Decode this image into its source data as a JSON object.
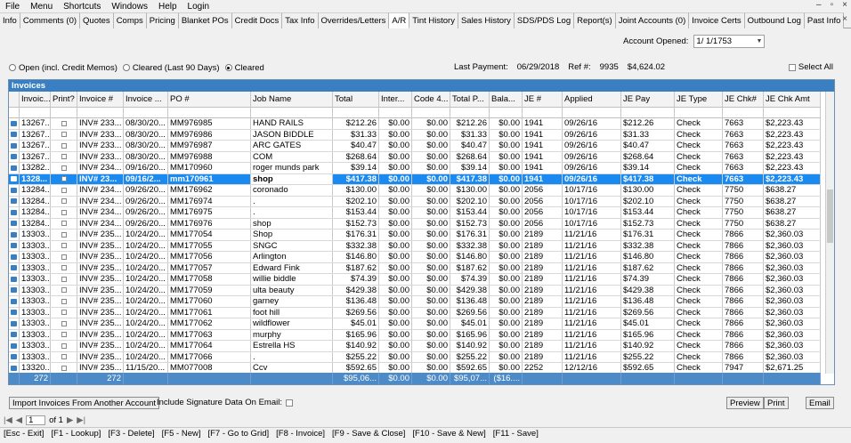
{
  "menu": [
    "File",
    "Menu",
    "Shortcuts",
    "Windows",
    "Help",
    "Login"
  ],
  "window_controls": {
    "min": "–",
    "restore": "▫",
    "close": "×"
  },
  "tabs": [
    "Info",
    "Comments (0)",
    "Quotes",
    "Comps",
    "Pricing",
    "Blanket POs",
    "Credit Docs",
    "Tax Info",
    "Overrides/Letters",
    "A/R",
    "Tint History",
    "Sales History",
    "SDS/PDS Log",
    "Report(s)",
    "Joint Accounts (0)",
    "Invoice Certs",
    "Outbound Log",
    "Past Info"
  ],
  "active_tab": "A/R",
  "account_opened": {
    "label": "Account Opened:",
    "value": "1/  1/1753"
  },
  "filters": {
    "open": "Open (incl. Credit Memos)",
    "cleared90": "Cleared (Last 90 Days)",
    "cleared": "Cleared",
    "selected": "cleared"
  },
  "payment": {
    "last_payment_label": "Last Payment:",
    "last_payment_date": "06/29/2018",
    "ref_label": "Ref #:",
    "ref": "9935",
    "amount": "$4,624.02"
  },
  "select_all": "Select All",
  "grid": {
    "title": "Invoices",
    "columns": [
      "",
      "Invoic...",
      "Print?",
      "Invoice #",
      "Invoice ...",
      "PO #",
      "Job Name",
      "Total",
      "Inter...",
      "Code 4...",
      "Total P...",
      "Bala...",
      "JE #",
      "Applied",
      "JE Pay",
      "JE Type",
      "JE Chk#",
      "JE Chk Amt"
    ],
    "rows": [
      [
        "13267...",
        "",
        "INV# 233...",
        "08/30/20...",
        "MM976985",
        "HAND RAILS",
        "$212.26",
        "$0.00",
        "$0.00",
        "$212.26",
        "$0.00",
        "1941",
        "09/26/16",
        "$212.26",
        "Check",
        "7663",
        "$2,223.43"
      ],
      [
        "13267...",
        "",
        "INV# 233...",
        "08/30/20...",
        "MM976986",
        "JASON BIDDLE",
        "$31.33",
        "$0.00",
        "$0.00",
        "$31.33",
        "$0.00",
        "1941",
        "09/26/16",
        "$31.33",
        "Check",
        "7663",
        "$2,223.43"
      ],
      [
        "13267...",
        "",
        "INV# 233...",
        "08/30/20...",
        "MM976987",
        "ARC GATES",
        "$40.47",
        "$0.00",
        "$0.00",
        "$40.47",
        "$0.00",
        "1941",
        "09/26/16",
        "$40.47",
        "Check",
        "7663",
        "$2,223.43"
      ],
      [
        "13267...",
        "",
        "INV# 233...",
        "08/30/20...",
        "MM976988",
        "COM",
        "$268.64",
        "$0.00",
        "$0.00",
        "$268.64",
        "$0.00",
        "1941",
        "09/26/16",
        "$268.64",
        "Check",
        "7663",
        "$2,223.43"
      ],
      [
        "13282...",
        "",
        "INV# 234...",
        "09/16/20...",
        "MM170960",
        "roger munds park",
        "$39.14",
        "$0.00",
        "$0.00",
        "$39.14",
        "$0.00",
        "1941",
        "09/26/16",
        "$39.14",
        "Check",
        "7663",
        "$2,223.43"
      ],
      [
        "1328...",
        "",
        "INV# 23...",
        "09/16/2...",
        "mm170961",
        "shop",
        "$417.38",
        "$0.00",
        "$0.00",
        "$417.38",
        "$0.00",
        "1941",
        "09/26/16",
        "$417.38",
        "Check",
        "7663",
        "$2,223.43"
      ],
      [
        "13284...",
        "",
        "INV# 234...",
        "09/26/20...",
        "MM176962",
        "coronado",
        "$130.00",
        "$0.00",
        "$0.00",
        "$130.00",
        "$0.00",
        "2056",
        "10/17/16",
        "$130.00",
        "Check",
        "7750",
        "$638.27"
      ],
      [
        "13284...",
        "",
        "INV# 234...",
        "09/26/20...",
        "MM176974",
        ".",
        "$202.10",
        "$0.00",
        "$0.00",
        "$202.10",
        "$0.00",
        "2056",
        "10/17/16",
        "$202.10",
        "Check",
        "7750",
        "$638.27"
      ],
      [
        "13284...",
        "",
        "INV# 234...",
        "09/26/20...",
        "MM176975",
        ".",
        "$153.44",
        "$0.00",
        "$0.00",
        "$153.44",
        "$0.00",
        "2056",
        "10/17/16",
        "$153.44",
        "Check",
        "7750",
        "$638.27"
      ],
      [
        "13284...",
        "",
        "INV# 234...",
        "09/26/20...",
        "MM176976",
        "shop",
        "$152.73",
        "$0.00",
        "$0.00",
        "$152.73",
        "$0.00",
        "2056",
        "10/17/16",
        "$152.73",
        "Check",
        "7750",
        "$638.27"
      ],
      [
        "13303...",
        "",
        "INV# 235...",
        "10/24/20...",
        "MM177054",
        "Shop",
        "$176.31",
        "$0.00",
        "$0.00",
        "$176.31",
        "$0.00",
        "2189",
        "11/21/16",
        "$176.31",
        "Check",
        "7866",
        "$2,360.03"
      ],
      [
        "13303...",
        "",
        "INV# 235...",
        "10/24/20...",
        "MM177055",
        "SNGC",
        "$332.38",
        "$0.00",
        "$0.00",
        "$332.38",
        "$0.00",
        "2189",
        "11/21/16",
        "$332.38",
        "Check",
        "7866",
        "$2,360.03"
      ],
      [
        "13303...",
        "",
        "INV# 235...",
        "10/24/20...",
        "MM177056",
        "Arlington",
        "$146.80",
        "$0.00",
        "$0.00",
        "$146.80",
        "$0.00",
        "2189",
        "11/21/16",
        "$146.80",
        "Check",
        "7866",
        "$2,360.03"
      ],
      [
        "13303...",
        "",
        "INV# 235...",
        "10/24/20...",
        "MM177057",
        "Edward Fink",
        "$187.62",
        "$0.00",
        "$0.00",
        "$187.62",
        "$0.00",
        "2189",
        "11/21/16",
        "$187.62",
        "Check",
        "7866",
        "$2,360.03"
      ],
      [
        "13303...",
        "",
        "INV# 235...",
        "10/24/20...",
        "MM177058",
        "willie biddle",
        "$74.39",
        "$0.00",
        "$0.00",
        "$74.39",
        "$0.00",
        "2189",
        "11/21/16",
        "$74.39",
        "Check",
        "7866",
        "$2,360.03"
      ],
      [
        "13303...",
        "",
        "INV# 235...",
        "10/24/20...",
        "MM177059",
        "ulta beauty",
        "$429.38",
        "$0.00",
        "$0.00",
        "$429.38",
        "$0.00",
        "2189",
        "11/21/16",
        "$429.38",
        "Check",
        "7866",
        "$2,360.03"
      ],
      [
        "13303...",
        "",
        "INV# 235...",
        "10/24/20...",
        "MM177060",
        "garney",
        "$136.48",
        "$0.00",
        "$0.00",
        "$136.48",
        "$0.00",
        "2189",
        "11/21/16",
        "$136.48",
        "Check",
        "7866",
        "$2,360.03"
      ],
      [
        "13303...",
        "",
        "INV# 235...",
        "10/24/20...",
        "MM177061",
        "foot hill",
        "$269.56",
        "$0.00",
        "$0.00",
        "$269.56",
        "$0.00",
        "2189",
        "11/21/16",
        "$269.56",
        "Check",
        "7866",
        "$2,360.03"
      ],
      [
        "13303...",
        "",
        "INV# 235...",
        "10/24/20...",
        "MM177062",
        "wildflower",
        "$45.01",
        "$0.00",
        "$0.00",
        "$45.01",
        "$0.00",
        "2189",
        "11/21/16",
        "$45.01",
        "Check",
        "7866",
        "$2,360.03"
      ],
      [
        "13303...",
        "",
        "INV# 235...",
        "10/24/20...",
        "MM177063",
        "murphy",
        "$165.96",
        "$0.00",
        "$0.00",
        "$165.96",
        "$0.00",
        "2189",
        "11/21/16",
        "$165.96",
        "Check",
        "7866",
        "$2,360.03"
      ],
      [
        "13303...",
        "",
        "INV# 235...",
        "10/24/20...",
        "MM177064",
        "Estrella HS",
        "$140.92",
        "$0.00",
        "$0.00",
        "$140.92",
        "$0.00",
        "2189",
        "11/21/16",
        "$140.92",
        "Check",
        "7866",
        "$2,360.03"
      ],
      [
        "13303...",
        "",
        "INV# 235...",
        "10/24/20...",
        "MM177066",
        ".",
        "$255.22",
        "$0.00",
        "$0.00",
        "$255.22",
        "$0.00",
        "2189",
        "11/21/16",
        "$255.22",
        "Check",
        "7866",
        "$2,360.03"
      ],
      [
        "13320...",
        "",
        "INV# 235...",
        "11/15/20...",
        "MM077008",
        "Ccv",
        "$592.65",
        "$0.00",
        "$0.00",
        "$592.65",
        "$0.00",
        "2252",
        "12/12/16",
        "$592.65",
        "Check",
        "7947",
        "$2,671.25"
      ]
    ],
    "selected_row": 5,
    "footer": [
      "",
      "272",
      "",
      "272",
      "",
      "",
      "",
      "$95,06...",
      "$0.00",
      "$0.00",
      "$95,07...",
      "($16....",
      "",
      "",
      "",
      "",
      "",
      ""
    ]
  },
  "buttons": {
    "import": "Import Invoices From Another Account",
    "sig_label": "Include Signature Data On Email:",
    "preview": "Preview",
    "print": "Print",
    "email": "Email"
  },
  "pager": {
    "page": "1",
    "of": "of 1"
  },
  "hotkeys": [
    "[Esc - Exit]",
    "[F1 - Lookup]",
    "[F3 - Delete]",
    "[F5 - New]",
    "[F7 - Go to Grid]",
    "[F8 - Invoice]",
    "[F9 - Save & Close]",
    "[F10 - Save & New]",
    "[F11 - Save]"
  ]
}
